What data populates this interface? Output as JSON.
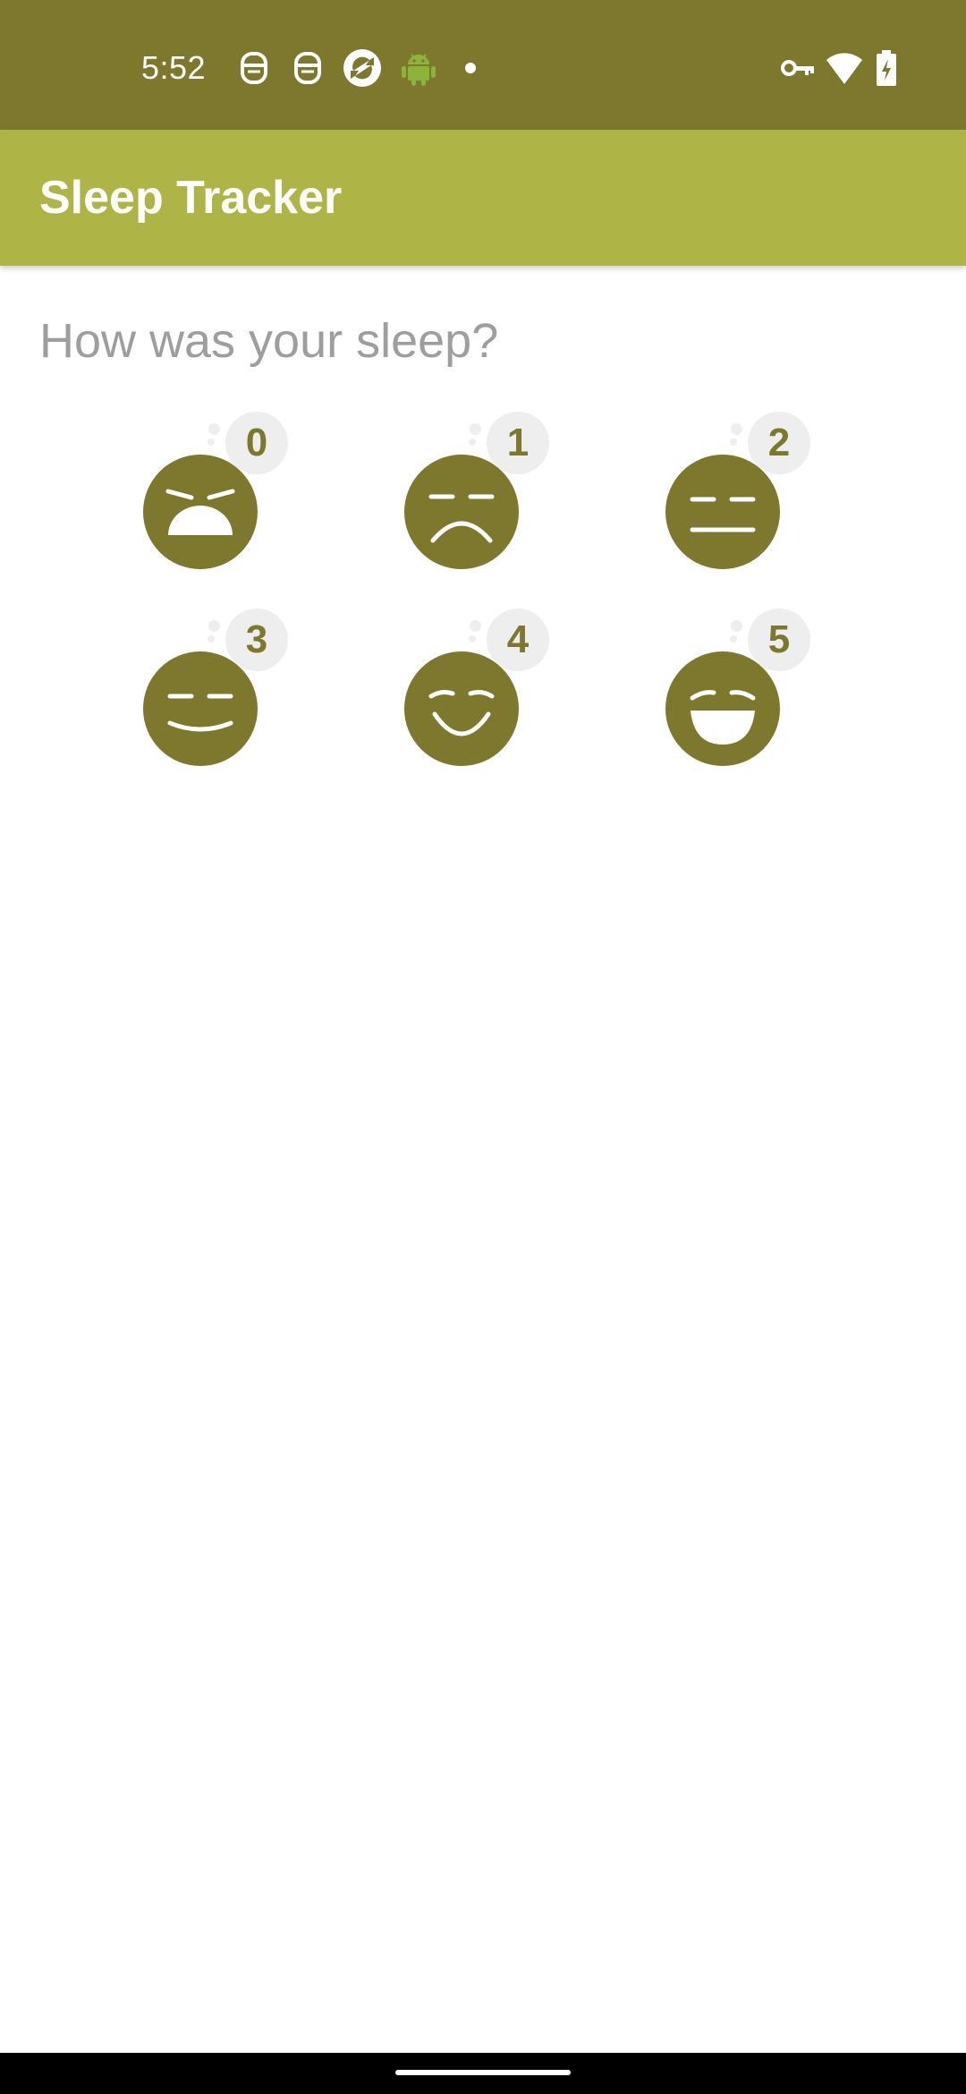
{
  "status_bar": {
    "time": "5:52",
    "icons_left": [
      "robot-notification-icon",
      "robot-notification-icon",
      "sync-app-icon",
      "android-icon",
      "more-dot-icon"
    ],
    "icons_right": [
      "vpn-key-icon",
      "wifi-icon",
      "battery-charging-icon"
    ],
    "background": "#7e772e"
  },
  "app_bar": {
    "title": "Sleep Tracker",
    "background": "#afb446"
  },
  "content": {
    "question": "How was your sleep?",
    "ratings": [
      {
        "value": "0",
        "face": "very-bad-face-icon"
      },
      {
        "value": "1",
        "face": "sad-face-icon"
      },
      {
        "value": "2",
        "face": "neutral-face-icon"
      },
      {
        "value": "3",
        "face": "slight-smile-face-icon"
      },
      {
        "value": "4",
        "face": "smile-face-icon"
      },
      {
        "value": "5",
        "face": "laughing-face-icon"
      }
    ],
    "accent_color": "#7e772e"
  }
}
